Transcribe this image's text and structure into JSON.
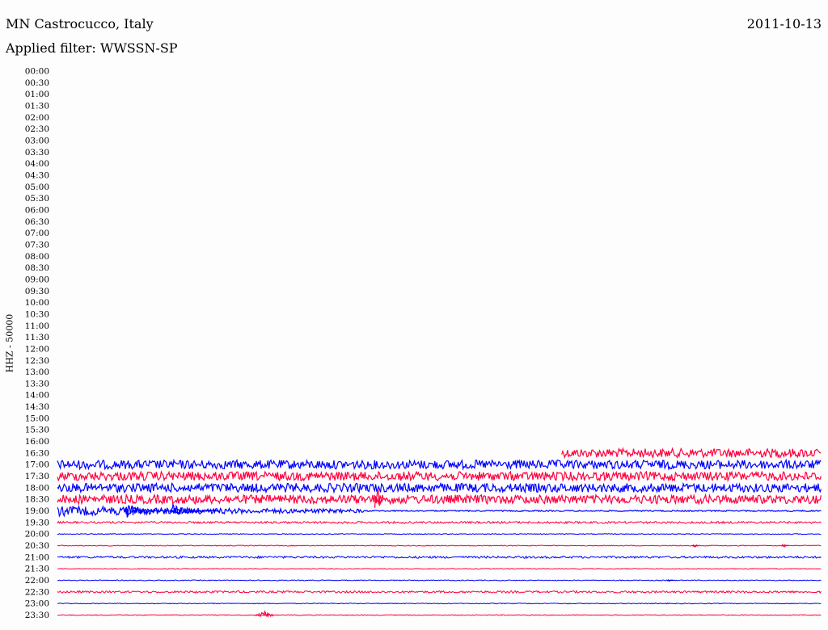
{
  "header": {
    "station": "MN Castrocucco, Italy",
    "date": "2011-10-13",
    "filter": "Applied filter: WWSSN-SP"
  },
  "chart_data": {
    "type": "line",
    "channel_label": "HHZ - 50000",
    "row_labels": [
      "00:00",
      "00:30",
      "01:00",
      "01:30",
      "02:00",
      "02:30",
      "03:00",
      "03:30",
      "04:00",
      "04:30",
      "05:00",
      "05:30",
      "06:00",
      "06:30",
      "07:00",
      "07:30",
      "08:00",
      "08:30",
      "09:00",
      "09:30",
      "10:00",
      "10:30",
      "11:00",
      "11:30",
      "12:00",
      "12:30",
      "13:00",
      "13:30",
      "14:00",
      "14:30",
      "15:00",
      "15:30",
      "16:00",
      "16:30",
      "17:00",
      "17:30",
      "18:00",
      "18:30",
      "19:00",
      "19:30",
      "20:00",
      "20:30",
      "21:00",
      "21:30",
      "22:00",
      "22:30",
      "23:00",
      "23:30"
    ],
    "row_minutes": 30,
    "colors": [
      "#0000ff",
      "#ff0040"
    ],
    "traces": [
      {
        "row": "16:30",
        "start_min": 19.8,
        "end_min": 30,
        "amplitude": "large",
        "color": "#ff0040"
      },
      {
        "row": "17:00",
        "start_min": 0,
        "end_min": 30,
        "amplitude": "large",
        "color": "#0000ff"
      },
      {
        "row": "17:30",
        "start_min": 0,
        "end_min": 30,
        "amplitude": "large",
        "color": "#ff0040"
      },
      {
        "row": "18:00",
        "start_min": 0,
        "end_min": 30,
        "amplitude": "large",
        "color": "#0000ff"
      },
      {
        "row": "18:30",
        "start_min": 0,
        "end_min": 30,
        "amplitude": "large",
        "color": "#ff0040"
      },
      {
        "row": "19:00",
        "start_min": 0,
        "end_min": 30,
        "amplitude": "decaying",
        "color": "#0000ff"
      },
      {
        "row": "19:30",
        "start_min": 0,
        "end_min": 30,
        "amplitude": "small",
        "color": "#ff0040"
      },
      {
        "row": "20:00",
        "start_min": 0,
        "end_min": 30,
        "amplitude": "flat",
        "color": "#0000ff"
      },
      {
        "row": "20:30",
        "start_min": 0,
        "end_min": 30,
        "amplitude": "flat",
        "color": "#ff0040"
      },
      {
        "row": "21:00",
        "start_min": 0,
        "end_min": 30,
        "amplitude": "small",
        "color": "#0000ff"
      },
      {
        "row": "21:30",
        "start_min": 0,
        "end_min": 30,
        "amplitude": "flat",
        "color": "#ff0040"
      },
      {
        "row": "22:00",
        "start_min": 0,
        "end_min": 30,
        "amplitude": "flat",
        "color": "#0000ff"
      },
      {
        "row": "22:30",
        "start_min": 0,
        "end_min": 30,
        "amplitude": "small",
        "color": "#ff0040"
      },
      {
        "row": "23:00",
        "start_min": 0,
        "end_min": 30,
        "amplitude": "flat",
        "color": "#0000ff"
      },
      {
        "row": "23:30",
        "start_min": 0,
        "end_min": 30,
        "amplitude": "flat",
        "color": "#ff0040"
      }
    ],
    "events": [
      {
        "row": "18:30",
        "minute": 12.5,
        "type": "spike"
      },
      {
        "row": "19:00",
        "minute": 2.7,
        "type": "coda"
      },
      {
        "row": "19:00",
        "minute": 4.5,
        "type": "coda"
      },
      {
        "row": "20:30",
        "minute": 25.0,
        "type": "blip"
      },
      {
        "row": "20:30",
        "minute": 28.5,
        "type": "blip"
      },
      {
        "row": "22:00",
        "minute": 24.0,
        "type": "blip"
      },
      {
        "row": "23:30",
        "minute": 7.8,
        "type": "burst"
      }
    ]
  }
}
